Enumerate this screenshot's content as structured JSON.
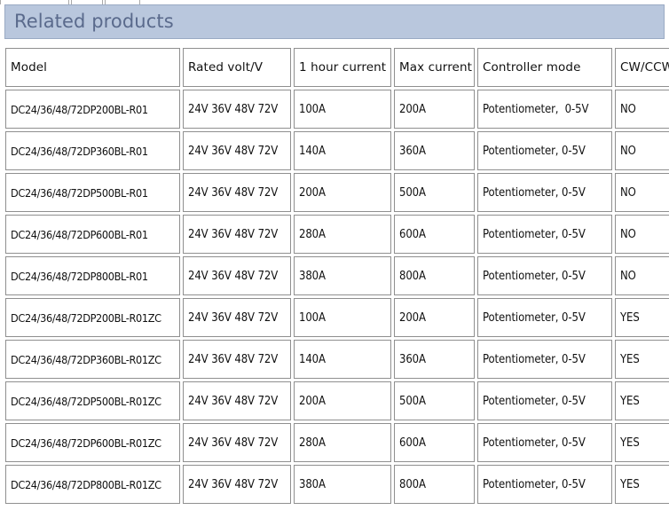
{
  "banner": {
    "title": "Related products"
  },
  "table": {
    "columns": [
      "Model",
      "Rated volt/V",
      "1 hour current",
      "Max current",
      "Controller mode",
      "CW/CCW"
    ],
    "rows": [
      {
        "model": "DC24/36/48/72DP200BL-R01",
        "rated_volt": "24V 36V 48V 72V",
        "one_hour_current": "100A",
        "max_current": "200A",
        "controller_mode": "Potentiometer,  0-5V",
        "cw_ccw": "NO"
      },
      {
        "model": "DC24/36/48/72DP360BL-R01",
        "rated_volt": "24V 36V 48V 72V",
        "one_hour_current": "140A",
        "max_current": "360A",
        "controller_mode": "Potentiometer, 0-5V",
        "cw_ccw": "NO"
      },
      {
        "model": "DC24/36/48/72DP500BL-R01",
        "rated_volt": "24V 36V 48V 72V",
        "one_hour_current": "200A",
        "max_current": "500A",
        "controller_mode": "Potentiometer, 0-5V",
        "cw_ccw": "NO"
      },
      {
        "model": "DC24/36/48/72DP600BL-R01",
        "rated_volt": "24V 36V 48V 72V",
        "one_hour_current": "280A",
        "max_current": "600A",
        "controller_mode": "Potentiometer, 0-5V",
        "cw_ccw": "NO"
      },
      {
        "model": "DC24/36/48/72DP800BL-R01",
        "rated_volt": "24V 36V 48V 72V",
        "one_hour_current": "380A",
        "max_current": "800A",
        "controller_mode": "Potentiometer, 0-5V",
        "cw_ccw": "NO"
      },
      {
        "model": "DC24/36/48/72DP200BL-R01ZC",
        "rated_volt": "24V 36V 48V 72V",
        "one_hour_current": "100A",
        "max_current": "200A",
        "controller_mode": "Potentiometer, 0-5V",
        "cw_ccw": "YES"
      },
      {
        "model": "DC24/36/48/72DP360BL-R01ZC",
        "rated_volt": "24V 36V 48V 72V",
        "one_hour_current": "140A",
        "max_current": "360A",
        "controller_mode": "Potentiometer, 0-5V",
        "cw_ccw": "YES"
      },
      {
        "model": "DC24/36/48/72DP500BL-R01ZC",
        "rated_volt": "24V 36V 48V 72V",
        "one_hour_current": "200A",
        "max_current": "500A",
        "controller_mode": "Potentiometer, 0-5V",
        "cw_ccw": "YES"
      },
      {
        "model": "DC24/36/48/72DP600BL-R01ZC",
        "rated_volt": "24V 36V 48V 72V",
        "one_hour_current": "280A",
        "max_current": "600A",
        "controller_mode": "Potentiometer, 0-5V",
        "cw_ccw": "YES"
      },
      {
        "model": "DC24/36/48/72DP800BL-R01ZC",
        "rated_volt": "24V 36V 48V 72V",
        "one_hour_current": "380A",
        "max_current": "800A",
        "controller_mode": "Potentiometer, 0-5V",
        "cw_ccw": "YES"
      }
    ]
  },
  "colors": {
    "banner_background": "#b9c7dd",
    "banner_border": "#9aaac4",
    "banner_text": "#5a6a8c",
    "cell_border": "#8f8f8f",
    "cell_background": "#ffffff",
    "text": "#111111"
  }
}
